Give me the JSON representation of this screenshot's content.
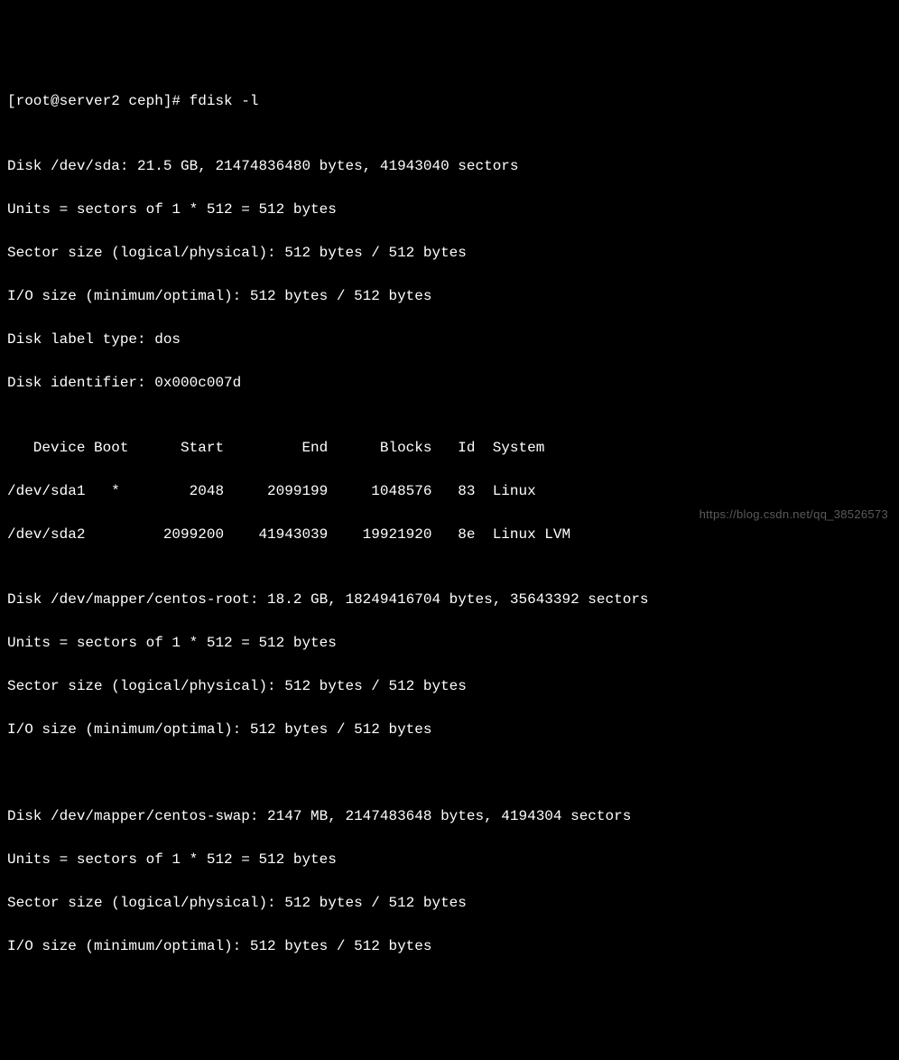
{
  "prompt": "[root@server2 ceph]# ",
  "command": "fdisk -l",
  "blank1": "",
  "disk1": {
    "header": "Disk /dev/sda: 21.5 GB, 21474836480 bytes, 41943040 sectors",
    "units": "Units = sectors of 1 * 512 = 512 bytes",
    "sector_size": "Sector size (logical/physical): 512 bytes / 512 bytes",
    "io_size": "I/O size (minimum/optimal): 512 bytes / 512 bytes",
    "label_type": "Disk label type: dos",
    "identifier": "Disk identifier: 0x000c007d"
  },
  "blank2": "",
  "partition_header": "   Device Boot      Start         End      Blocks   Id  System",
  "partition_row1": "/dev/sda1   *        2048     2099199     1048576   83  Linux",
  "partition_row2": "/dev/sda2         2099200    41943039    19921920   8e  Linux LVM",
  "blank3": "",
  "disk2": {
    "header": "Disk /dev/mapper/centos-root: 18.2 GB, 18249416704 bytes, 35643392 sectors",
    "units": "Units = sectors of 1 * 512 = 512 bytes",
    "sector_size": "Sector size (logical/physical): 512 bytes / 512 bytes",
    "io_size": "I/O size (minimum/optimal): 512 bytes / 512 bytes"
  },
  "blank4": "",
  "blank5": "",
  "disk3": {
    "header": "Disk /dev/mapper/centos-swap: 2147 MB, 2147483648 bytes, 4194304 sectors",
    "units": "Units = sectors of 1 * 512 = 512 bytes",
    "sector_size": "Sector size (logical/physical): 512 bytes / 512 bytes",
    "io_size": "I/O size (minimum/optimal): 512 bytes / 512 bytes"
  },
  "watermark": "https://blog.csdn.net/qq_38526573"
}
